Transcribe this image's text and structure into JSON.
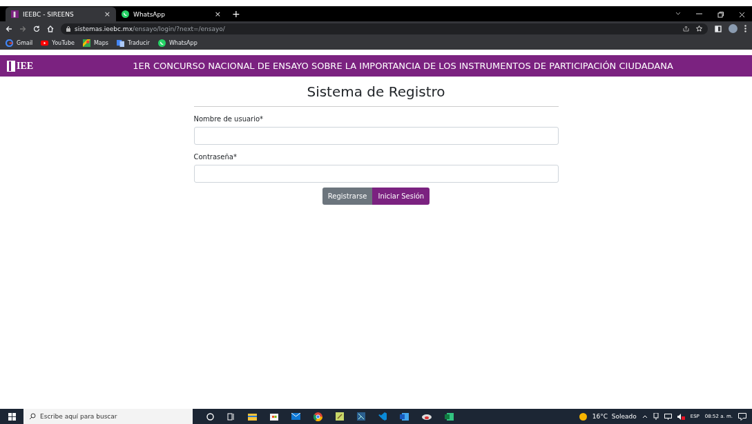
{
  "browser": {
    "tabs": [
      {
        "title": "IEEBC - SIREENS",
        "close": "×",
        "selected": true
      },
      {
        "title": "WhatsApp",
        "close": "×",
        "selected": false
      }
    ],
    "new_tab": "+",
    "url": {
      "host": "sistemas.ieebc.mx",
      "path": "/ensayo/login/?next=/ensayo/"
    },
    "bookmarks": [
      {
        "label": "Gmail",
        "kind": "google"
      },
      {
        "label": "YouTube",
        "kind": "youtube"
      },
      {
        "label": "Maps",
        "kind": "maps"
      },
      {
        "label": "Traducir",
        "kind": "translate"
      },
      {
        "label": "WhatsApp",
        "kind": "whatsapp"
      }
    ]
  },
  "header": {
    "logo": "IEE",
    "title": "1ER CONCURSO NACIONAL DE ENSAYO SOBRE LA IMPORTANCIA DE LOS INSTRUMENTOS DE PARTICIPACIÓN CIUDADANA"
  },
  "form": {
    "title": "Sistema de Registro",
    "fields": [
      {
        "label": "Nombre de usuario*"
      },
      {
        "label": "Contraseña*"
      }
    ],
    "buttons": [
      {
        "label": "Registrarse",
        "kind": "secondary"
      },
      {
        "label": "Iniciar Sesión",
        "kind": "primary"
      }
    ]
  },
  "taskbar": {
    "search_placeholder": "Escribe aquí para buscar",
    "weather": "16°C  Soleado",
    "language": "ESP",
    "time": "08:52 a. m."
  }
}
